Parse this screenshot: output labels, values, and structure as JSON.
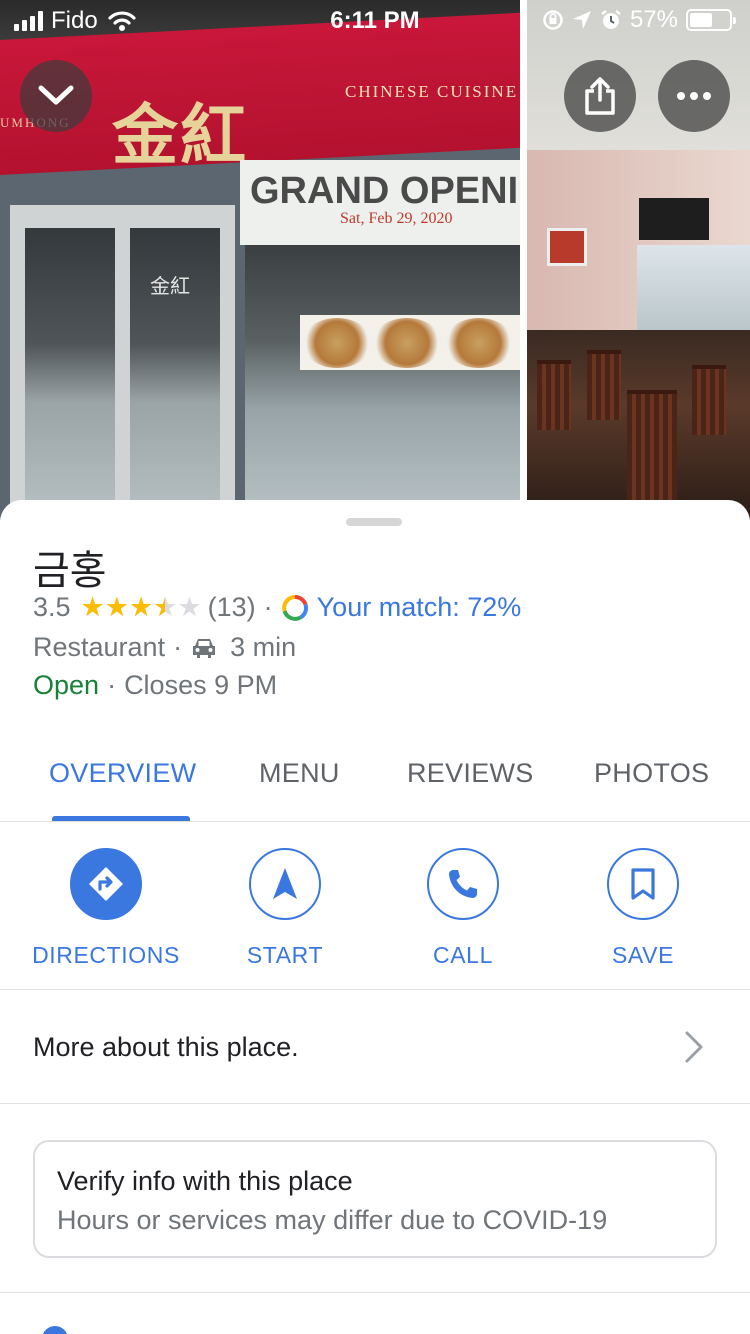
{
  "status_bar": {
    "carrier": "Fido",
    "time": "6:11 PM",
    "battery": "57%",
    "battery_level": 0.57
  },
  "photos": {
    "sign_chinese": "CHINESE CUISINE",
    "sign_romanized": "UMHONG",
    "banner_title": "GRAND OPENI",
    "banner_date": "Sat, Feb 29, 2020",
    "logo_glyphs": "金紅"
  },
  "place": {
    "name": "금홍",
    "rating": "3.5",
    "rating_value": 3.5,
    "review_count": "(13)",
    "separator": "·",
    "match": "Your match: 72%",
    "category": "Restaurant",
    "drive_time": "3 min",
    "open_status": "Open",
    "closes": "Closes 9 PM"
  },
  "tabs": [
    {
      "label": "OVERVIEW",
      "active": true
    },
    {
      "label": "MENU",
      "active": false
    },
    {
      "label": "REVIEWS",
      "active": false
    },
    {
      "label": "PHOTOS",
      "active": false
    }
  ],
  "actions": [
    {
      "label": "DIRECTIONS",
      "icon": "directions-icon"
    },
    {
      "label": "START",
      "icon": "navigation-arrow-icon"
    },
    {
      "label": "CALL",
      "icon": "phone-icon"
    },
    {
      "label": "SAVE",
      "icon": "bookmark-icon"
    }
  ],
  "more": {
    "label": "More about this place."
  },
  "verify": {
    "title": "Verify info with this place",
    "subtitle": "Hours or services may differ due to COVID-19"
  },
  "colors": {
    "accent": "#3a78e0",
    "open": "#188038",
    "star": "#fbbc04",
    "text_secondary": "#70757a"
  }
}
